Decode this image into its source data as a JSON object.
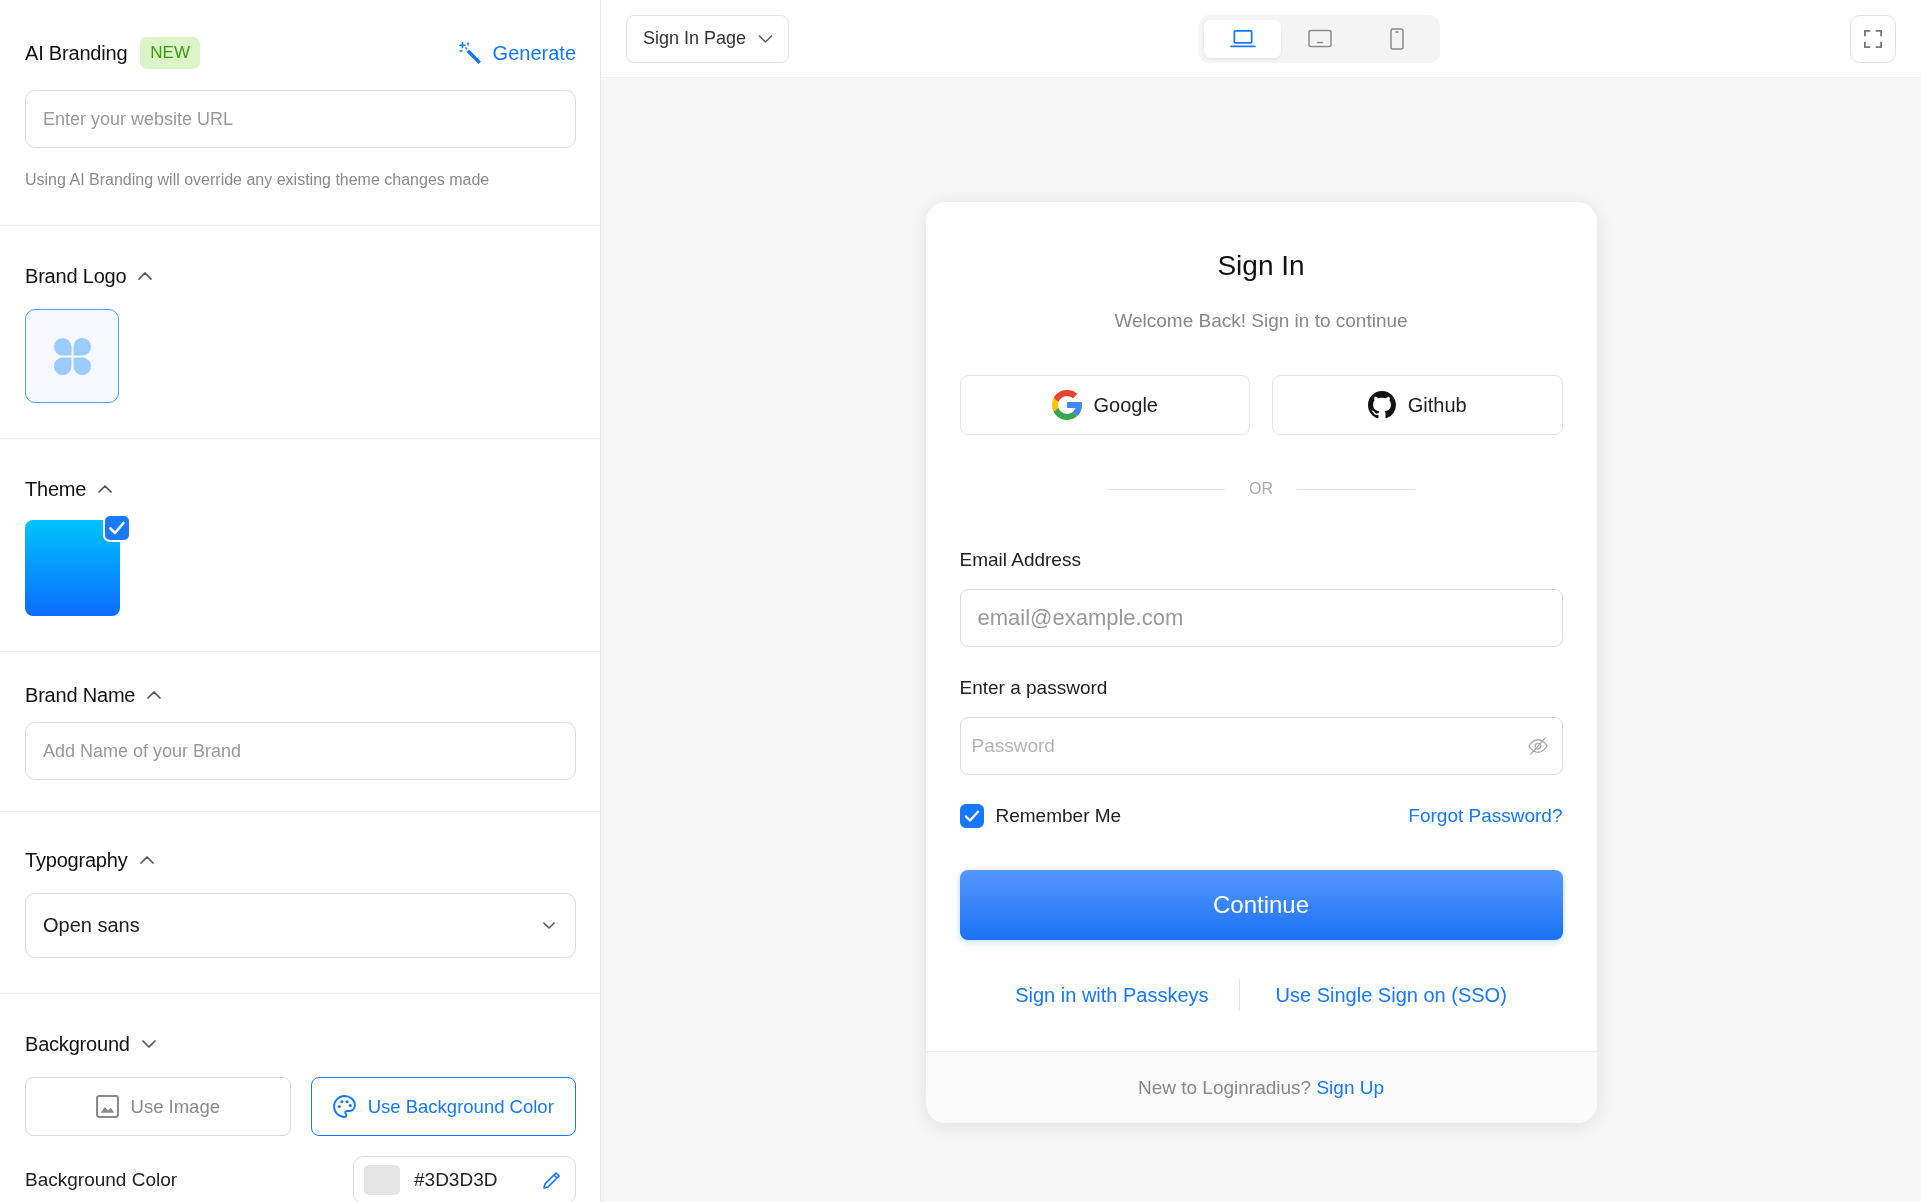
{
  "sidebar": {
    "ai_branding": {
      "title": "AI Branding",
      "badge": "NEW",
      "generate_button": "Generate",
      "url_field": {
        "placeholder": "Enter your website URL"
      },
      "hint": "Using AI Branding will override any existing theme changes made"
    },
    "sections": [
      {
        "kind": "logo",
        "title": "Brand Logo",
        "expanded": true
      },
      {
        "kind": "theme",
        "title": "Theme",
        "expanded": true,
        "themes": [
          {
            "selected": true
          }
        ]
      },
      {
        "kind": "text",
        "title": "Brand Name",
        "expanded": true,
        "field": {
          "placeholder": "Add Name of your Brand"
        }
      },
      {
        "kind": "select",
        "title": "Typography",
        "expanded": true,
        "field": {
          "value": "Open sans"
        }
      },
      {
        "kind": "background",
        "title": "Background",
        "expanded": false,
        "options": [
          {
            "kind": "image",
            "label": "Use Image",
            "selected": false
          },
          {
            "kind": "color",
            "label": "Use Background Color",
            "selected": true
          }
        ],
        "color_field": {
          "label": "Background Color",
          "value": "#3D3D3D"
        }
      }
    ]
  },
  "toolbar": {
    "page_select": {
      "value": "Sign In Page"
    },
    "devices": [
      {
        "kind": "laptop",
        "selected": true
      },
      {
        "kind": "tablet",
        "selected": false
      },
      {
        "kind": "phone",
        "selected": false
      }
    ]
  },
  "preview": {
    "title": "Sign In",
    "subtitle": "Welcome Back! Sign in to continue",
    "social_buttons": [
      {
        "kind": "google",
        "label": "Google"
      },
      {
        "kind": "github",
        "label": "Github"
      }
    ],
    "separator": "OR",
    "fields": [
      {
        "kind": "email",
        "label": "Email Address",
        "placeholder": "email@example.com"
      },
      {
        "kind": "password",
        "label": "Enter a password",
        "placeholder": "Password"
      }
    ],
    "remember_me": {
      "label": "Remember Me",
      "checked": true
    },
    "forgot_link": "Forgot Password?",
    "continue_button": "Continue",
    "alt_links": [
      "Sign in with Passkeys",
      "Use Single Sign on (SSO)"
    ],
    "footer": {
      "text": "New to Loginradius?",
      "link": "Sign Up"
    }
  }
}
